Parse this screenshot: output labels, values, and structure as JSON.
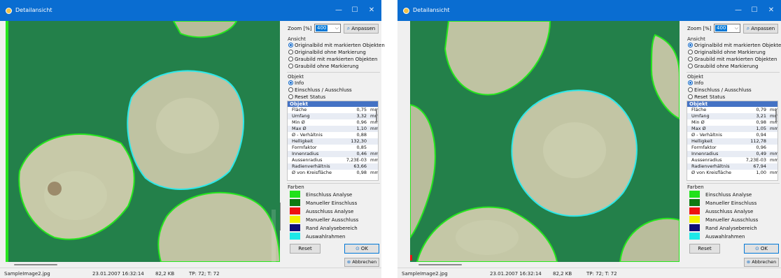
{
  "windows": [
    {
      "title": "Detailansicht",
      "window_controls": {
        "minimize": "—",
        "maximize": "☐",
        "close": "✕"
      },
      "zoom": {
        "label": "Zoom [%]",
        "value": "400",
        "fit_button": "Anpassen"
      },
      "view_mode": {
        "label": "Ansicht",
        "options": [
          "Originalbild mit markierten Objekten",
          "Originalbild ohne Markierung",
          "Graubild mit markierten Objekten",
          "Graubild ohne Markierung"
        ],
        "selected": 0
      },
      "object_mode": {
        "label": "Objekt",
        "options": [
          "Info",
          "Einschluss / Ausschluss",
          "Reset Status"
        ],
        "selected": 0
      },
      "object_table": {
        "header": "Objekt",
        "rows": [
          {
            "key": "Fläche",
            "value": "0,75",
            "unit": "mm²"
          },
          {
            "key": "Umfang",
            "value": "3,32",
            "unit": "mm"
          },
          {
            "key": "Min Ø",
            "value": "0,96",
            "unit": "mm"
          },
          {
            "key": "Max Ø",
            "value": "1,10",
            "unit": "mm"
          },
          {
            "key": "Ø - Verhältnis",
            "value": "0,88",
            "unit": ""
          },
          {
            "key": "Helligkeit",
            "value": "132,30",
            "unit": ""
          },
          {
            "key": "Formfaktor",
            "value": "0,85",
            "unit": ""
          },
          {
            "key": "Innenradius",
            "value": "0,46",
            "unit": "mm"
          },
          {
            "key": "Aussenradius",
            "value": "7,23E-03",
            "unit": "mm"
          },
          {
            "key": "Radienverhältnis",
            "value": "63,66",
            "unit": ""
          },
          {
            "key": "Ø von Kreisfläche",
            "value": "0,98",
            "unit": "mm"
          }
        ]
      },
      "colors": {
        "label": "Farben",
        "items": [
          {
            "label": "Einschluss Analyse",
            "color": "#21e21b"
          },
          {
            "label": "Manueller Einschluss",
            "color": "#0e7a12"
          },
          {
            "label": "Ausschluss Analyse",
            "color": "#ee1111"
          },
          {
            "label": "Manueller Ausschluss",
            "color": "#f2f200"
          },
          {
            "label": "Rand Analysebereich",
            "color": "#0d0d78"
          },
          {
            "label": "Auswahlrahmen",
            "color": "#1ee8e8"
          }
        ]
      },
      "buttons": {
        "reset": "Reset",
        "ok": "OK",
        "cancel": "Abbrechen"
      },
      "status": {
        "file": "SampleImage2.jpg",
        "date": "23.01.2007 16:32:14",
        "size": "82,2 KB",
        "tp": "TP: 72; T: 72"
      }
    },
    {
      "title": "Detailansicht",
      "window_controls": {
        "minimize": "—",
        "maximize": "☐",
        "close": "✕"
      },
      "zoom": {
        "label": "Zoom [%]",
        "value": "400",
        "fit_button": "Anpassen"
      },
      "view_mode": {
        "label": "Ansicht",
        "options": [
          "Originalbild mit markierten Objekten",
          "Originalbild ohne Markierung",
          "Graubild mit markierten Objekten",
          "Graubild ohne Markierung"
        ],
        "selected": 0
      },
      "object_mode": {
        "label": "Objekt",
        "options": [
          "Info",
          "Einschluss / Ausschluss",
          "Reset Status"
        ],
        "selected": 0
      },
      "object_table": {
        "header": "Objekt",
        "rows": [
          {
            "key": "Fläche",
            "value": "0,79",
            "unit": "mm²"
          },
          {
            "key": "Umfang",
            "value": "3,21",
            "unit": "mm"
          },
          {
            "key": "Min Ø",
            "value": "0,98",
            "unit": "mm"
          },
          {
            "key": "Max Ø",
            "value": "1,05",
            "unit": "mm"
          },
          {
            "key": "Ø - Verhältnis",
            "value": "0,94",
            "unit": ""
          },
          {
            "key": "Helligkeit",
            "value": "112,78",
            "unit": ""
          },
          {
            "key": "Formfaktor",
            "value": "0,96",
            "unit": ""
          },
          {
            "key": "Innenradius",
            "value": "0,49",
            "unit": "mm"
          },
          {
            "key": "Aussenradius",
            "value": "7,23E-03",
            "unit": "mm"
          },
          {
            "key": "Radienverhältnis",
            "value": "67,94",
            "unit": ""
          },
          {
            "key": "Ø von Kreisfläche",
            "value": "1,00",
            "unit": "mm"
          }
        ]
      },
      "colors": {
        "label": "Farben",
        "items": [
          {
            "label": "Einschluss Analyse",
            "color": "#21e21b"
          },
          {
            "label": "Manueller Einschluss",
            "color": "#0e7a12"
          },
          {
            "label": "Ausschluss Analyse",
            "color": "#ee1111"
          },
          {
            "label": "Manueller Ausschluss",
            "color": "#f2f200"
          },
          {
            "label": "Rand Analysebereich",
            "color": "#0d0d78"
          },
          {
            "label": "Auswahlrahmen",
            "color": "#1ee8e8"
          }
        ]
      },
      "buttons": {
        "reset": "Reset",
        "ok": "OK",
        "cancel": "Abbrechen"
      },
      "status": {
        "file": "SampleImage2.jpg",
        "date": "23.01.2007 16:32:14",
        "size": "82,2 KB",
        "tp": "TP: 72; T: 72"
      }
    }
  ]
}
